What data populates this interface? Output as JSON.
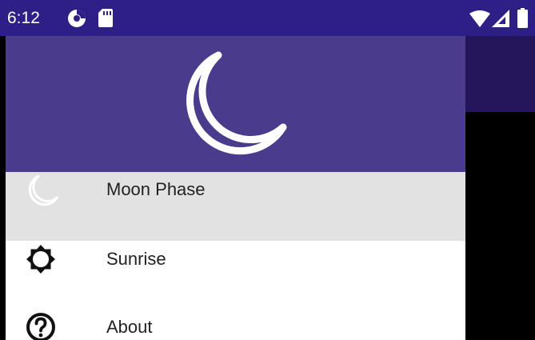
{
  "status_bar": {
    "time": "6:12",
    "left_icons": [
      "data-saver-icon",
      "sd-card-icon"
    ],
    "right_icons": [
      "wifi-icon",
      "cell-signal-icon",
      "battery-icon"
    ]
  },
  "colors": {
    "status_bar": "#2d1f86",
    "drawer_header": "#4b3b8c",
    "app_bar": "#24145a",
    "selected_item": "#e2e2e2"
  },
  "drawer": {
    "header_icon": "moon-icon",
    "items": [
      {
        "label": "Moon Phase",
        "icon": "moon-icon",
        "selected": true
      },
      {
        "label": "Sunrise",
        "icon": "sun-icon",
        "selected": false
      },
      {
        "label": "About",
        "icon": "help-icon",
        "selected": false
      }
    ]
  }
}
